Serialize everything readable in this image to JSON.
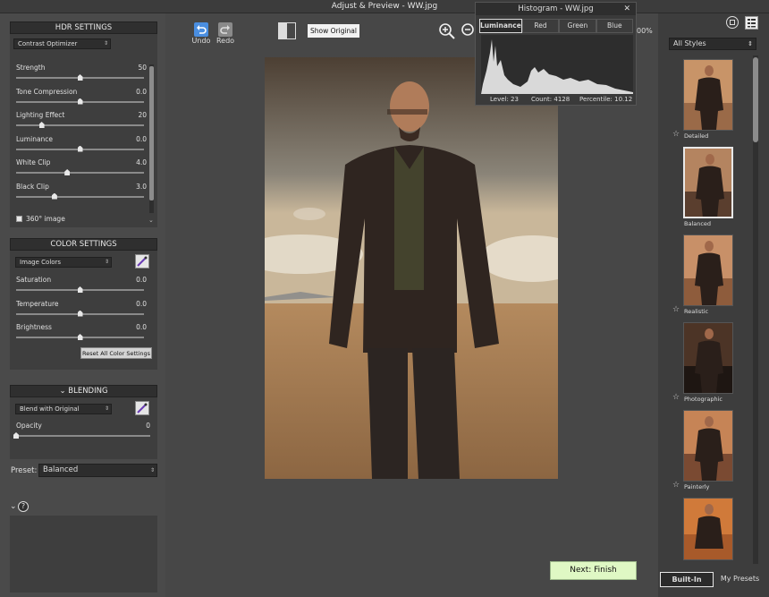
{
  "window": {
    "title": "Adjust & Preview - WW.jpg",
    "close": "✕"
  },
  "hdr": {
    "header": "HDR SETTINGS",
    "method": "Contrast Optimizer",
    "sliders": [
      {
        "label": "Strength",
        "value": "50",
        "pos": 0.5
      },
      {
        "label": "Tone Compression",
        "value": "0.0",
        "pos": 0.5
      },
      {
        "label": "Lighting Effect",
        "value": "20",
        "pos": 0.2
      },
      {
        "label": "Luminance",
        "value": "0.0",
        "pos": 0.5
      },
      {
        "label": "White Clip",
        "value": "4.0",
        "pos": 0.4
      },
      {
        "label": "Black Clip",
        "value": "3.0",
        "pos": 0.3
      }
    ],
    "checkbox_label": "360° image"
  },
  "color": {
    "header": "COLOR SETTINGS",
    "mode": "Image Colors",
    "sliders": [
      {
        "label": "Saturation",
        "value": "0.0",
        "pos": 0.5
      },
      {
        "label": "Temperature",
        "value": "0.0",
        "pos": 0.5
      },
      {
        "label": "Brightness",
        "value": "0.0",
        "pos": 0.5
      }
    ],
    "reset_label": "Reset All Color Settings"
  },
  "blending": {
    "header": "BLENDING",
    "mode": "Blend with Original",
    "opacity_label": "Opacity",
    "opacity_value": "0",
    "opacity_pos": 0.0
  },
  "preset": {
    "label": "Preset:",
    "value": "Balanced"
  },
  "toolbar": {
    "undo": "Undo",
    "redo": "Redo",
    "show_original": "Show Original",
    "zoom_pct": "00%"
  },
  "histogram": {
    "title": "Histogram - WW.jpg",
    "tabs": [
      "Luminance",
      "Red",
      "Green",
      "Blue"
    ],
    "active_tab": "Luminance",
    "level": "Level: 23",
    "count": "Count: 4128",
    "percentile": "Percentile: 10.12"
  },
  "styles": {
    "dropdown": "All Styles",
    "items": [
      {
        "label": "Detailed"
      },
      {
        "label": "Balanced"
      },
      {
        "label": "Realistic"
      },
      {
        "label": "Photographic"
      },
      {
        "label": "Painterly"
      }
    ]
  },
  "bottom_tabs": {
    "builtin": "Built-In",
    "mypresets": "My Presets"
  },
  "next_label": "Next: Finish",
  "colors": {
    "panel": "#3e3e3e",
    "accent": "#dff8c4",
    "dark": "#2f2f2f"
  }
}
